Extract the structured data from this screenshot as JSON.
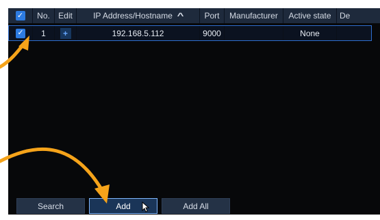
{
  "table": {
    "headers": {
      "no": "No.",
      "edit": "Edit",
      "ip": "IP Address/Hostname",
      "sort_glyph": "^",
      "port": "Port",
      "manufacturer": "Manufacturer",
      "active_state": "Active state",
      "device_cut": "De"
    },
    "rows": [
      {
        "no": "1",
        "edit_glyph": "+",
        "ip": "192.168.5.112",
        "port": "9000",
        "manufacturer": "",
        "active_state": "None"
      }
    ]
  },
  "buttons": {
    "search": "Search",
    "add": "Add",
    "add_all": "Add All"
  },
  "icons": {
    "checkbox_header": "check-icon",
    "checkbox_row": "check-icon",
    "edit": "plus-icon",
    "sort": "chevron-up-icon",
    "cursor": "mouse-pointer-icon",
    "annotation_1": "curved-arrow-icon",
    "annotation_2": "curved-arrow-icon"
  },
  "colors": {
    "annotation_arrow": "#f5a31a",
    "panel_bg": "#07080a",
    "header_bg": "#1e2a3c",
    "accent": "#2d7be0"
  }
}
